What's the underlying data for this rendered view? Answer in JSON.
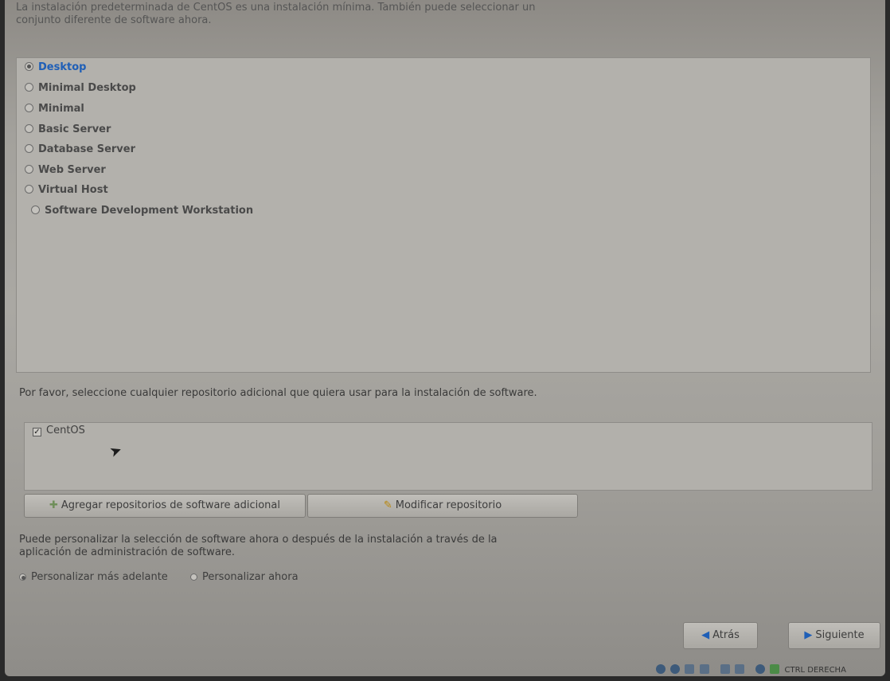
{
  "intro_text": "La instalación predeterminada de CentOS es una instalación mínima. También puede seleccionar un conjunto diferente de software ahora.",
  "groups": [
    {
      "label": "Desktop",
      "selected": true
    },
    {
      "label": "Minimal Desktop",
      "selected": false
    },
    {
      "label": "Minimal",
      "selected": false
    },
    {
      "label": "Basic Server",
      "selected": false
    },
    {
      "label": "Database Server",
      "selected": false
    },
    {
      "label": "Web Server",
      "selected": false
    },
    {
      "label": "Virtual Host",
      "selected": false
    },
    {
      "label": "Software Development Workstation",
      "selected": false
    }
  ],
  "repo_prompt": "Por favor, seleccione cualquier repositorio adicional que quiera usar para la instalación de software.",
  "repos": [
    {
      "label": "CentOS",
      "checked": true
    }
  ],
  "buttons": {
    "add_repo": "Agregar repositorios de software adicional",
    "modify_repo": "Modificar repositorio",
    "back": "Atrás",
    "next": "Siguiente"
  },
  "customize_text": "Puede personalizar la selección de software ahora o después de la instalación a través de la aplicación de administración de software.",
  "customize_options": [
    {
      "label": "Personalizar más adelante",
      "selected": true
    },
    {
      "label": "Personalizar ahora",
      "selected": false
    }
  ],
  "tray": {
    "host_key": "CTRL DERECHA"
  },
  "colors": {
    "accent": "#1f5fb7"
  }
}
